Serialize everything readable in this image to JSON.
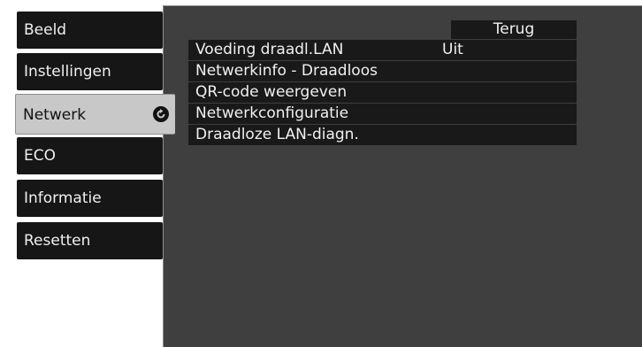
{
  "sidebar": {
    "items": [
      {
        "label": "Beeld"
      },
      {
        "label": "Instellingen"
      },
      {
        "label": "Netwerk",
        "active": true
      },
      {
        "label": "ECO"
      },
      {
        "label": "Informatie"
      },
      {
        "label": "Resetten"
      }
    ],
    "active_icon": "enter-arrow-icon"
  },
  "panel": {
    "back_label": "Terug",
    "rows": [
      {
        "label": "Voeding draadl.LAN",
        "value": "Uit"
      },
      {
        "label": "Netwerkinfo - Draadloos",
        "value": ""
      },
      {
        "label": "QR-code weergeven",
        "value": ""
      },
      {
        "label": "Netwerkconfiguratie",
        "value": ""
      },
      {
        "label": "Draadloze LAN-diagn.",
        "value": ""
      }
    ]
  },
  "colors": {
    "menu_background": "#161616",
    "menu_active_background": "#c8c8c8",
    "panel_background": "#3f3f3f",
    "row_background": "#191919",
    "text": "#f0f0f0"
  }
}
